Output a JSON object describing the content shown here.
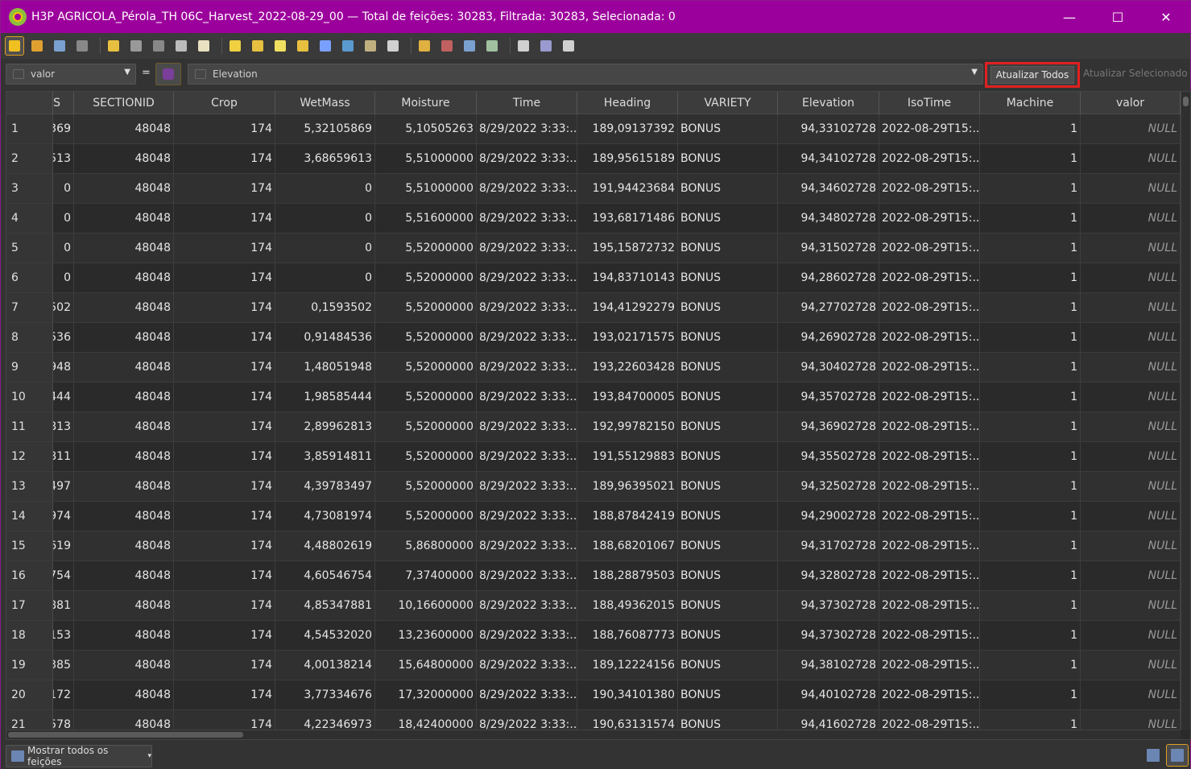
{
  "window": {
    "title": "H3P AGRICOLA_Pérola_TH 06C_Harvest_2022-08-29_00 — Total de feições: 30283, Filtrada: 30283, Selecionada: 0",
    "minimize": "—",
    "maximize": "☐",
    "close": "✕"
  },
  "toolbar": {
    "icons": [
      "edit-pencil-icon",
      "multi-edit-icon",
      "save-edits-icon",
      "reload-icon",
      "add-feature-icon",
      "delete-feature-icon",
      "cut-icon",
      "copy-icon",
      "paste-icon",
      "expression-select-icon",
      "select-all-icon",
      "invert-selection-icon",
      "deselect-icon",
      "filter-icon",
      "move-selection-top-icon",
      "pan-to-selection-icon",
      "zoom-to-selection-icon",
      "new-field-icon",
      "delete-field-icon",
      "field-calculator-icon",
      "conditional-format-icon",
      "dock-icon",
      "actions-icon",
      "zoom-icon"
    ]
  },
  "filterbar": {
    "field_value": "valor",
    "equals": "=",
    "expression_value": "Elevation",
    "update_all_label": "Atualizar Todos",
    "update_selected_label": "Atualizar Selecionado"
  },
  "table": {
    "columns": [
      "S",
      "SECTIONID",
      "Crop",
      "WetMass",
      "Moisture",
      "Time",
      "Heading",
      "VARIETY",
      "Elevation",
      "IsoTime",
      "Machine",
      "valor"
    ],
    "rows": [
      {
        "n": "1",
        "cells": [
          "369",
          "48048",
          "174",
          "5,32105869",
          "5,10505263",
          "8/29/2022 3:33:...",
          "189,09137392",
          "BONUS",
          "94,33102728",
          "2022-08-29T15:...",
          "1",
          "NULL"
        ]
      },
      {
        "n": "2",
        "cells": [
          "513",
          "48048",
          "174",
          "3,68659613",
          "5,51000000",
          "8/29/2022 3:33:...",
          "189,95615189",
          "BONUS",
          "94,34102728",
          "2022-08-29T15:...",
          "1",
          "NULL"
        ]
      },
      {
        "n": "3",
        "cells": [
          "0",
          "48048",
          "174",
          "0",
          "5,51000000",
          "8/29/2022 3:33:...",
          "191,94423684",
          "BONUS",
          "94,34602728",
          "2022-08-29T15:...",
          "1",
          "NULL"
        ]
      },
      {
        "n": "4",
        "cells": [
          "0",
          "48048",
          "174",
          "0",
          "5,51600000",
          "8/29/2022 3:33:...",
          "193,68171486",
          "BONUS",
          "94,34802728",
          "2022-08-29T15:...",
          "1",
          "NULL"
        ]
      },
      {
        "n": "5",
        "cells": [
          "0",
          "48048",
          "174",
          "0",
          "5,52000000",
          "8/29/2022 3:33:...",
          "195,15872732",
          "BONUS",
          "94,31502728",
          "2022-08-29T15:...",
          "1",
          "NULL"
        ]
      },
      {
        "n": "6",
        "cells": [
          "0",
          "48048",
          "174",
          "0",
          "5,52000000",
          "8/29/2022 3:33:...",
          "194,83710143",
          "BONUS",
          "94,28602728",
          "2022-08-29T15:...",
          "1",
          "NULL"
        ]
      },
      {
        "n": "7",
        "cells": [
          "502",
          "48048",
          "174",
          "0,1593502",
          "5,52000000",
          "8/29/2022 3:33:...",
          "194,41292279",
          "BONUS",
          "94,27702728",
          "2022-08-29T15:...",
          "1",
          "NULL"
        ]
      },
      {
        "n": "8",
        "cells": [
          "536",
          "48048",
          "174",
          "0,91484536",
          "5,52000000",
          "8/29/2022 3:33:...",
          "193,02171575",
          "BONUS",
          "94,26902728",
          "2022-08-29T15:...",
          "1",
          "NULL"
        ]
      },
      {
        "n": "9",
        "cells": [
          "948",
          "48048",
          "174",
          "1,48051948",
          "5,52000000",
          "8/29/2022 3:33:...",
          "193,22603428",
          "BONUS",
          "94,30402728",
          "2022-08-29T15:...",
          "1",
          "NULL"
        ]
      },
      {
        "n": "10",
        "cells": [
          "444",
          "48048",
          "174",
          "1,98585444",
          "5,52000000",
          "8/29/2022 3:33:...",
          "193,84700005",
          "BONUS",
          "94,35702728",
          "2022-08-29T15:...",
          "1",
          "NULL"
        ]
      },
      {
        "n": "11",
        "cells": [
          "813",
          "48048",
          "174",
          "2,89962813",
          "5,52000000",
          "8/29/2022 3:33:...",
          "192,99782150",
          "BONUS",
          "94,36902728",
          "2022-08-29T15:...",
          "1",
          "NULL"
        ]
      },
      {
        "n": "12",
        "cells": [
          "811",
          "48048",
          "174",
          "3,85914811",
          "5,52000000",
          "8/29/2022 3:33:...",
          "191,55129883",
          "BONUS",
          "94,35502728",
          "2022-08-29T15:...",
          "1",
          "NULL"
        ]
      },
      {
        "n": "13",
        "cells": [
          "497",
          "48048",
          "174",
          "4,39783497",
          "5,52000000",
          "8/29/2022 3:33:...",
          "189,96395021",
          "BONUS",
          "94,32502728",
          "2022-08-29T15:...",
          "1",
          "NULL"
        ]
      },
      {
        "n": "14",
        "cells": [
          "974",
          "48048",
          "174",
          "4,73081974",
          "5,52000000",
          "8/29/2022 3:33:...",
          "188,87842419",
          "BONUS",
          "94,29002728",
          "2022-08-29T15:...",
          "1",
          "NULL"
        ]
      },
      {
        "n": "15",
        "cells": [
          "619",
          "48048",
          "174",
          "4,48802619",
          "5,86800000",
          "8/29/2022 3:33:...",
          "188,68201067",
          "BONUS",
          "94,31702728",
          "2022-08-29T15:...",
          "1",
          "NULL"
        ]
      },
      {
        "n": "16",
        "cells": [
          "754",
          "48048",
          "174",
          "4,60546754",
          "7,37400000",
          "8/29/2022 3:33:...",
          "188,28879503",
          "BONUS",
          "94,32802728",
          "2022-08-29T15:...",
          "1",
          "NULL"
        ]
      },
      {
        "n": "17",
        "cells": [
          "881",
          "48048",
          "174",
          "4,85347881",
          "10,16600000",
          "8/29/2022 3:33:...",
          "188,49362015",
          "BONUS",
          "94,37302728",
          "2022-08-29T15:...",
          "1",
          "NULL"
        ]
      },
      {
        "n": "18",
        "cells": [
          "153",
          "48048",
          "174",
          "4,54532020",
          "13,23600000",
          "8/29/2022 3:33:...",
          "188,76087773",
          "BONUS",
          "94,37302728",
          "2022-08-29T15:...",
          "1",
          "NULL"
        ]
      },
      {
        "n": "19",
        "cells": [
          "385",
          "48048",
          "174",
          "4,00138214",
          "15,64800000",
          "8/29/2022 3:33:...",
          "189,12224156",
          "BONUS",
          "94,38102728",
          "2022-08-29T15:...",
          "1",
          "NULL"
        ]
      },
      {
        "n": "20",
        "cells": [
          "172",
          "48048",
          "174",
          "3,77334676",
          "17,32000000",
          "8/29/2022 3:33:...",
          "190,34101380",
          "BONUS",
          "94,40102728",
          "2022-08-29T15:...",
          "1",
          "NULL"
        ]
      },
      {
        "n": "21",
        "cells": [
          "578",
          "48048",
          "174",
          "4,22346973",
          "18,42400000",
          "8/29/2022 3:33:...",
          "190,63131574",
          "BONUS",
          "94,41602728",
          "2022-08-29T15:...",
          "1",
          "NULL"
        ]
      }
    ]
  },
  "statusbar": {
    "show_all_label": "Mostrar todos os feições",
    "view_icons": [
      "form-view-icon",
      "table-view-icon"
    ]
  },
  "colors": {
    "titlebar": "#9c009c",
    "highlight_border": "#e02020",
    "active_outline": "#e0a020"
  }
}
